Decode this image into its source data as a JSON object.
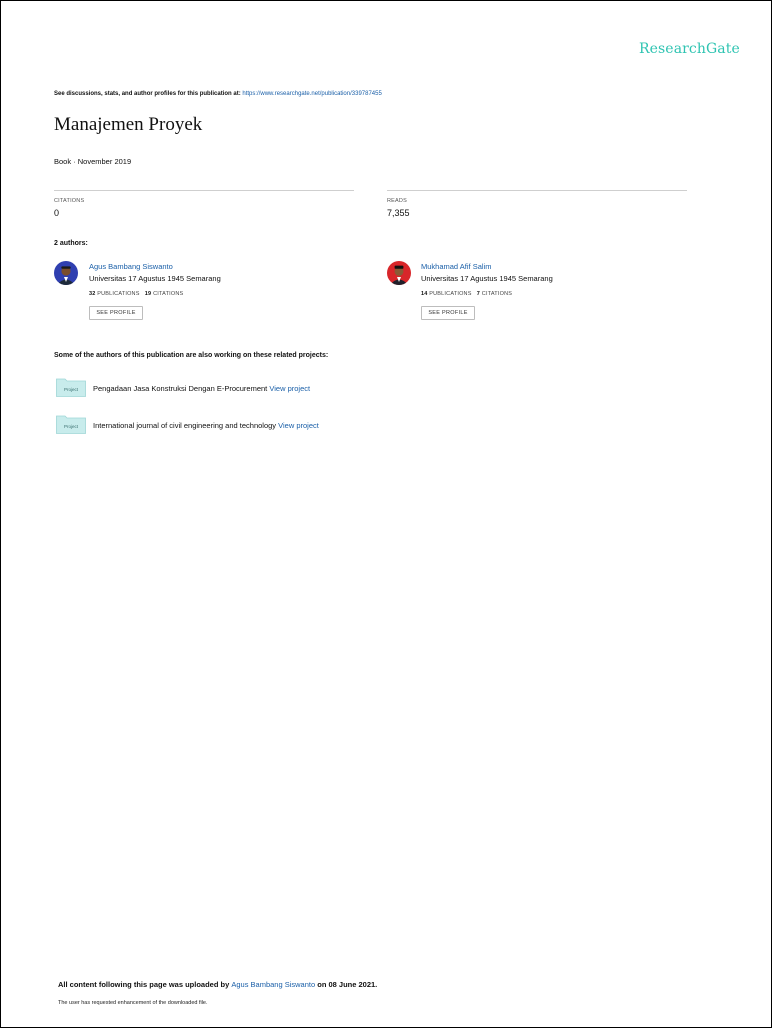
{
  "brand": {
    "name": "ResearchGate"
  },
  "intro": {
    "text": "See discussions, stats, and author profiles for this publication at: ",
    "url": "https://www.researchgate.net/publication/339787455"
  },
  "publication": {
    "title": "Manajemen Proyek",
    "type_date": "Book · November 2019"
  },
  "stats": {
    "citations_label": "CITATIONS",
    "citations_value": "0",
    "reads_label": "READS",
    "reads_value": "7,355"
  },
  "authors_label": "2 authors:",
  "authors": [
    {
      "name": "Agus Bambang Siswanto",
      "institution": "Universitas 17 Agustus 1945 Semarang",
      "publications_count": "32",
      "publications_label": "PUBLICATIONS",
      "citations_count": "19",
      "citations_label": "CITATIONS",
      "button": "SEE PROFILE"
    },
    {
      "name": "Mukhamad Afif Salim",
      "institution": "Universitas 17 Agustus 1945 Semarang",
      "publications_count": "14",
      "publications_label": "PUBLICATIONS",
      "citations_count": "7",
      "citations_label": "CITATIONS",
      "button": "SEE PROFILE"
    }
  ],
  "related_label": "Some of the authors of this publication are also working on these related projects:",
  "projects": [
    {
      "icon_label": "Project",
      "title": "Pengadaan Jasa Konstruksi Dengan E-Procurement ",
      "link": "View project"
    },
    {
      "icon_label": "Project",
      "title": "International journal of civil engineering and technology ",
      "link": "View project"
    }
  ],
  "footer": {
    "prefix": "All content following this page was uploaded by ",
    "uploader": "Agus Bambang Siswanto",
    "suffix": " on 08 June 2021.",
    "note": "The user has requested enhancement of the downloaded file."
  },
  "colors": {
    "brand": "#2fc4b2",
    "link": "#1a5fa8",
    "folder": "#c8ecec"
  }
}
